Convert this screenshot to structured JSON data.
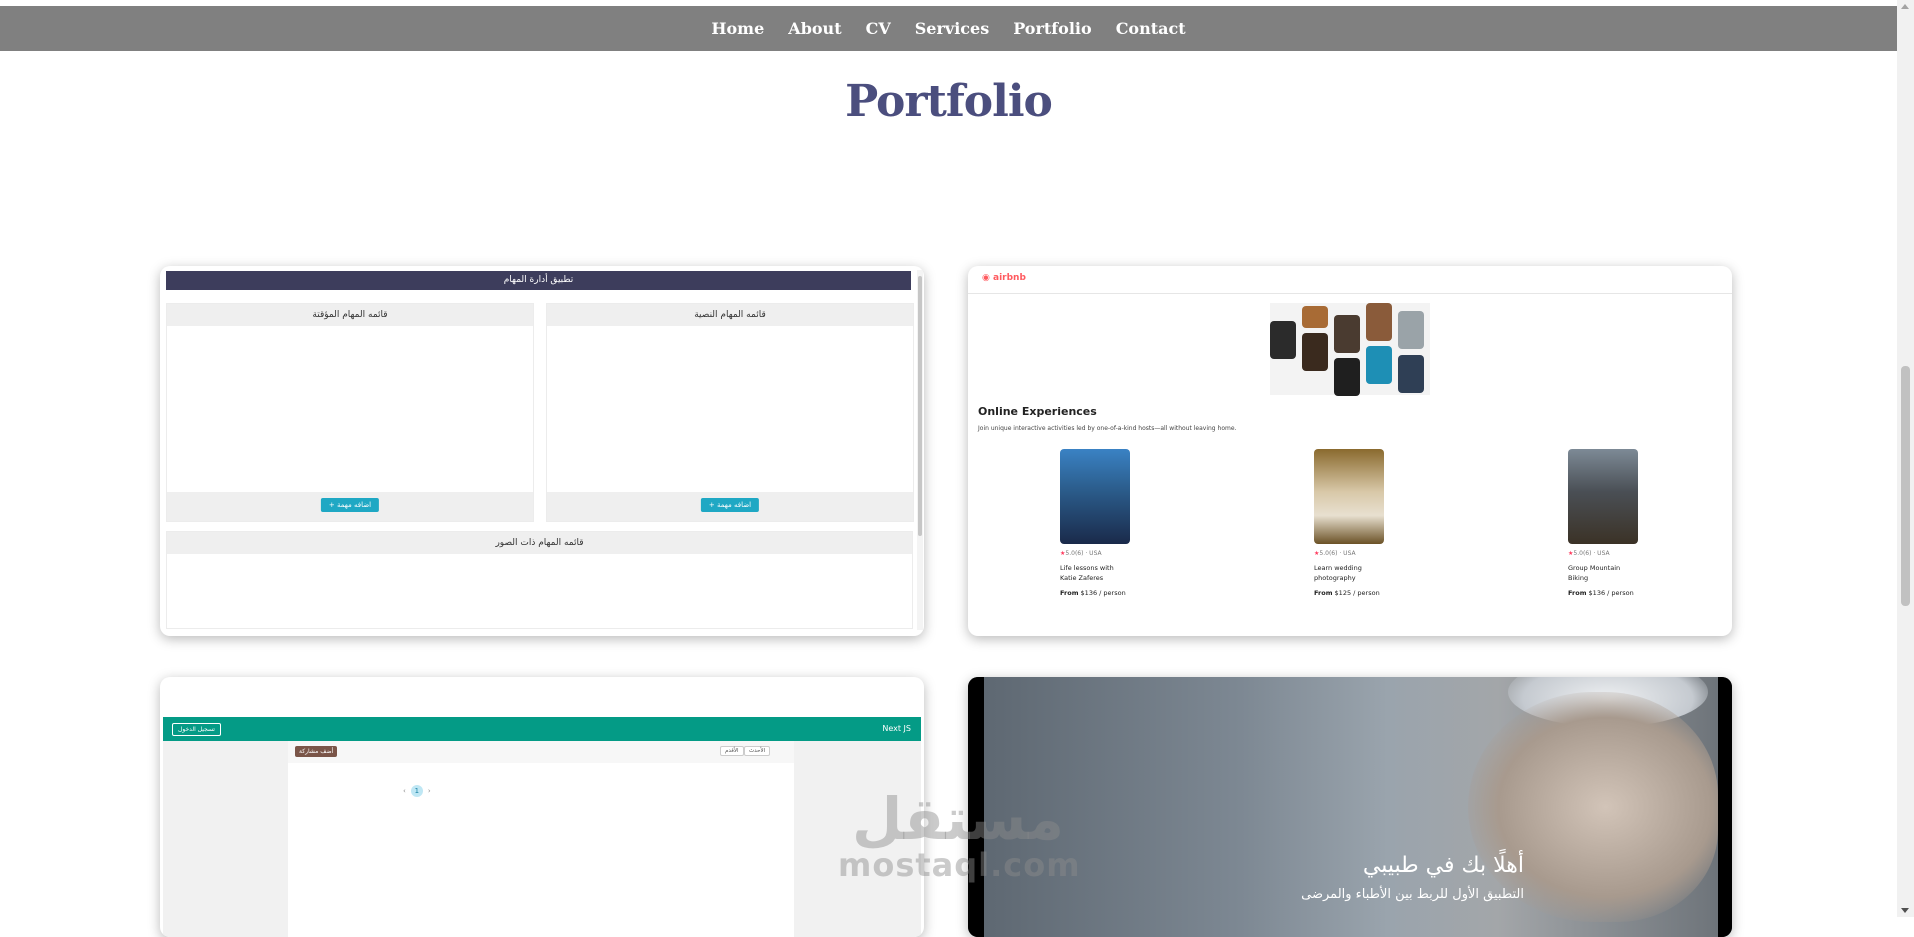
{
  "nav": {
    "items": [
      "Home",
      "About",
      "CV",
      "Services",
      "Portfolio",
      "Contact"
    ]
  },
  "section_title": "Portfolio",
  "task_app": {
    "header": "تطبيق أدارة المهام",
    "col_temp_title": "قائمه المهام المؤقتة",
    "col_text_title": "قائمه المهام النصية",
    "add_temp_btn": "+ اضافه مهمة",
    "add_text_btn": "+ اضافه مهمة",
    "images_title": "قائمه المهام ذات الصور"
  },
  "airbnb": {
    "logo": "airbnb",
    "heading": "Online Experiences",
    "subtitle": "Join unique interactive activities led by one-of-a-kind hosts—all without leaving home.",
    "items": [
      {
        "rating": "5.0",
        "reviews": "(6)",
        "country": "USA",
        "name": "Life lessons with Katie Zaferes",
        "from": "From",
        "price": "$136",
        "per": "/ person"
      },
      {
        "rating": "5.0",
        "reviews": "(6)",
        "country": "USA",
        "name": "Learn wedding photography",
        "from": "From",
        "price": "$125",
        "per": "/ person"
      },
      {
        "rating": "5.0",
        "reviews": "(6)",
        "country": "USA",
        "name": "Group Mountain Biking",
        "from": "From",
        "price": "$136",
        "per": "/ person"
      }
    ]
  },
  "nextjs": {
    "brand": "Next JS",
    "login_btn": "تسجيل الدخول",
    "add_btn": "أضف مشاركة",
    "filter_a": "الأحدث",
    "filter_b": "الأقدم",
    "prev": "‹",
    "page": "1",
    "next": "›"
  },
  "doctor": {
    "title": "أهلًا بك في طبيبي",
    "subtitle": "التطبيق الأول للربط بين الأطباء والمرضى"
  },
  "watermark": {
    "arabic": "مستقل",
    "latin": "mostaql.com"
  },
  "colors": {
    "nav": "#808080",
    "title": "#4b4e7e",
    "teal": "#049b86",
    "airbnb": "#ff5a5f"
  }
}
